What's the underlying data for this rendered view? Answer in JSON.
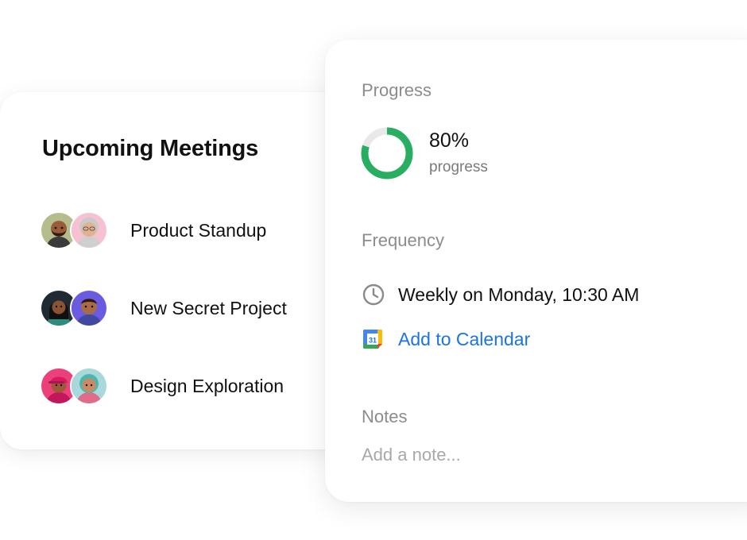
{
  "meetings": {
    "title": "Upcoming Meetings",
    "items": [
      {
        "label": "Product Standup",
        "avatars": [
          "avatar-bearded-man",
          "avatar-elderly-woman"
        ]
      },
      {
        "label": "New Secret Project",
        "avatars": [
          "avatar-woman-dark-hair",
          "avatar-man-purple"
        ]
      },
      {
        "label": "Design Exploration",
        "avatars": [
          "avatar-pink-cap",
          "avatar-teal-hair"
        ]
      }
    ]
  },
  "details": {
    "progress": {
      "label": "Progress",
      "percent": 80,
      "value_text": "80%",
      "caption": "progress",
      "color": "#27ae60",
      "track_color": "#e9e9e9"
    },
    "frequency": {
      "label": "Frequency",
      "schedule_icon": "clock-icon",
      "schedule": "Weekly on Monday, 10:30 AM",
      "calendar_icon": "google-calendar-icon",
      "calendar_link": "Add to Calendar",
      "calendar_day": "31",
      "link_color": "#1a73e8"
    },
    "notes": {
      "label": "Notes",
      "placeholder": "Add a note...",
      "value": ""
    }
  }
}
